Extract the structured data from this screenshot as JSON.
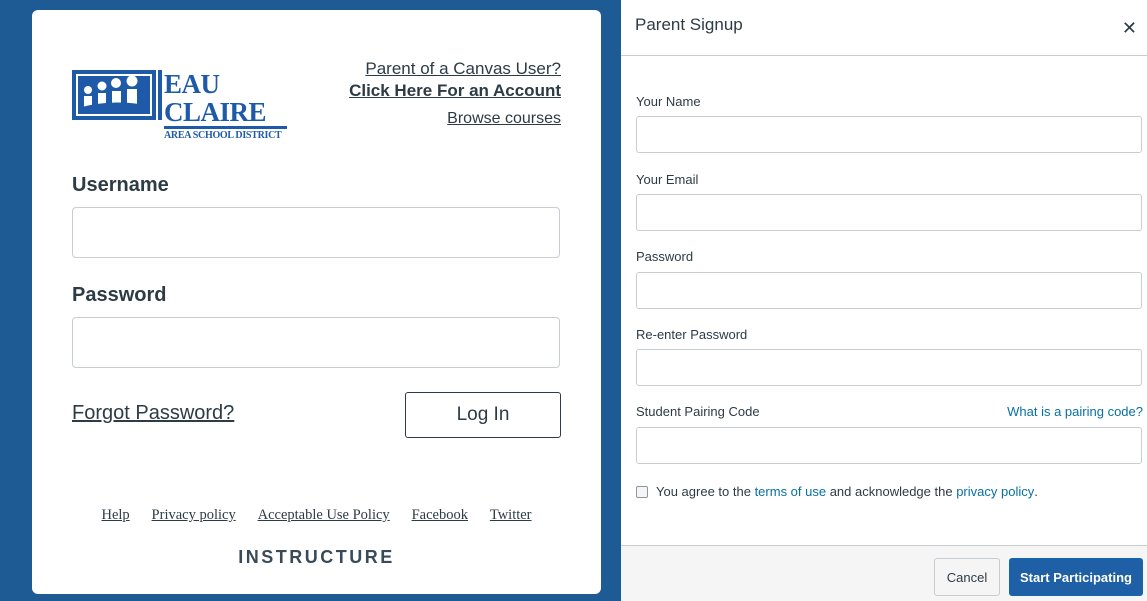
{
  "login": {
    "logo": {
      "line1": "EAU CLAIRE",
      "line2": "AREA SCHOOL DISTRICT"
    },
    "parent_question": "Parent of a Canvas User?",
    "parent_link": "Click Here For an Account",
    "browse_link": "Browse courses",
    "username_label": "Username",
    "username_value": "",
    "password_label": "Password",
    "password_value": "",
    "forgot_link": "Forgot Password?",
    "login_button": "Log In",
    "footer_links": [
      "Help",
      "Privacy policy",
      "Acceptable Use Policy",
      "Facebook",
      "Twitter"
    ],
    "brand": "INSTRUCTURE"
  },
  "modal": {
    "title": "Parent Signup",
    "close_icon": "close-icon",
    "fields": [
      {
        "label": "Your Name",
        "value": ""
      },
      {
        "label": "Your Email",
        "value": ""
      },
      {
        "label": "Password",
        "value": ""
      },
      {
        "label": "Re-enter Password",
        "value": ""
      },
      {
        "label": "Student Pairing Code",
        "value": ""
      }
    ],
    "pairing_help_link": "What is a pairing code?",
    "agree": {
      "prefix": "You agree to the ",
      "terms_link": "terms of use",
      "middle": " and acknowledge the ",
      "privacy_link": "privacy policy",
      "suffix": ".",
      "checked": false
    },
    "cancel_button": "Cancel",
    "start_button": "Start Participating"
  },
  "colors": {
    "brand_blue": "#1e5b94",
    "link_blue": "#0770a3",
    "primary_button": "#1f5fa5",
    "text": "#2d3b45"
  }
}
